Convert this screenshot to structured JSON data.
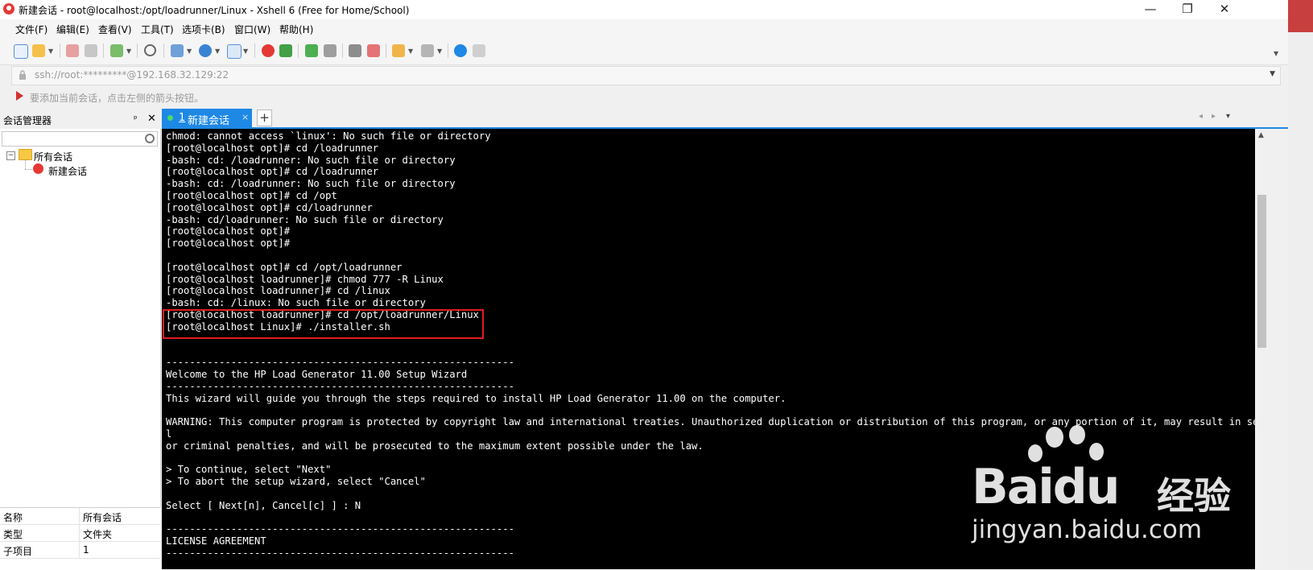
{
  "window": {
    "title": "新建会话 - root@localhost:/opt/loadrunner/Linux - Xshell 6 (Free for Home/School)",
    "minimize": "—",
    "maximize": "❐",
    "close": "✕"
  },
  "menu": [
    "文件(F)",
    "编辑(E)",
    "查看(V)",
    "工具(T)",
    "选项卡(B)",
    "窗口(W)",
    "帮助(H)"
  ],
  "toolbar": {
    "icons": [
      "new-session-icon",
      "open-folder-icon",
      "disconnect-icon",
      "reconnect-icon",
      "new-tab-icon",
      "find-icon",
      "copy-icon",
      "globe-icon",
      "font-icon",
      "xshell-icon",
      "xftp-icon",
      "fullscreen-icon",
      "lock-icon",
      "keyboard-icon",
      "highlight-icon",
      "compose-icon",
      "layout-icon",
      "help-icon",
      "chat-icon"
    ]
  },
  "address": {
    "text": "ssh://root:*********@192.168.32.129:22"
  },
  "hint": {
    "text": "要添加当前会话，点击左侧的箭头按钮。"
  },
  "session_manager": {
    "title": "会话管理器",
    "pin": "ᵖ",
    "close": "✕",
    "tree": {
      "toggle": "−",
      "root": "所有会话",
      "child": "新建会话"
    },
    "properties": [
      {
        "key": "名称",
        "value": "所有会话"
      },
      {
        "key": "类型",
        "value": "文件夹"
      },
      {
        "key": "子项目",
        "value": "1"
      }
    ]
  },
  "tabs": {
    "active": {
      "number": "1",
      "label": "新建会话",
      "close": "×"
    },
    "add": "+",
    "nav_prev": "◂",
    "nav_next": "▸",
    "menu": "▾"
  },
  "terminal": {
    "lines": [
      "chmod: cannot access `linux': No such file or directory",
      "[root@localhost opt]# cd /loadrunner",
      "-bash: cd: /loadrunner: No such file or directory",
      "[root@localhost opt]# cd /loadrunner",
      "-bash: cd: /loadrunner: No such file or directory",
      "[root@localhost opt]# cd /opt",
      "[root@localhost opt]# cd/loadrunner",
      "-bash: cd/loadrunner: No such file or directory",
      "[root@localhost opt]#",
      "[root@localhost opt]#",
      "",
      "[root@localhost opt]# cd /opt/loadrunner",
      "[root@localhost loadrunner]# chmod 777 -R Linux",
      "[root@localhost loadrunner]# cd /linux",
      "-bash: cd: /linux: No such file or directory",
      "[root@localhost loadrunner]# cd /opt/loadrunner/Linux",
      "[root@localhost Linux]# ./installer.sh",
      "",
      "",
      "-----------------------------------------------------------",
      "Welcome to the HP Load Generator 11.00 Setup Wizard",
      "-----------------------------------------------------------",
      "This wizard will guide you through the steps required to install HP Load Generator 11.00 on the computer.",
      "",
      "WARNING: This computer program is protected by copyright law and international treaties. Unauthorized duplication or distribution of this program, or any portion of it, may result in several civi",
      "l",
      "or criminal penalties, and will be prosecuted to the maximum extent possible under the law.",
      "",
      "> To continue, select \"Next\"",
      "> To abort the setup wizard, select \"Cancel\"",
      "",
      "Select [ Next[n], Cancel[c] ] : N",
      "",
      "-----------------------------------------------------------",
      "LICENSE AGREEMENT",
      "-----------------------------------------------------------"
    ]
  },
  "watermark": {
    "brand": "Bai",
    "brand2": "du",
    "cn": "经验",
    "url": "jingyan.baidu.com"
  }
}
